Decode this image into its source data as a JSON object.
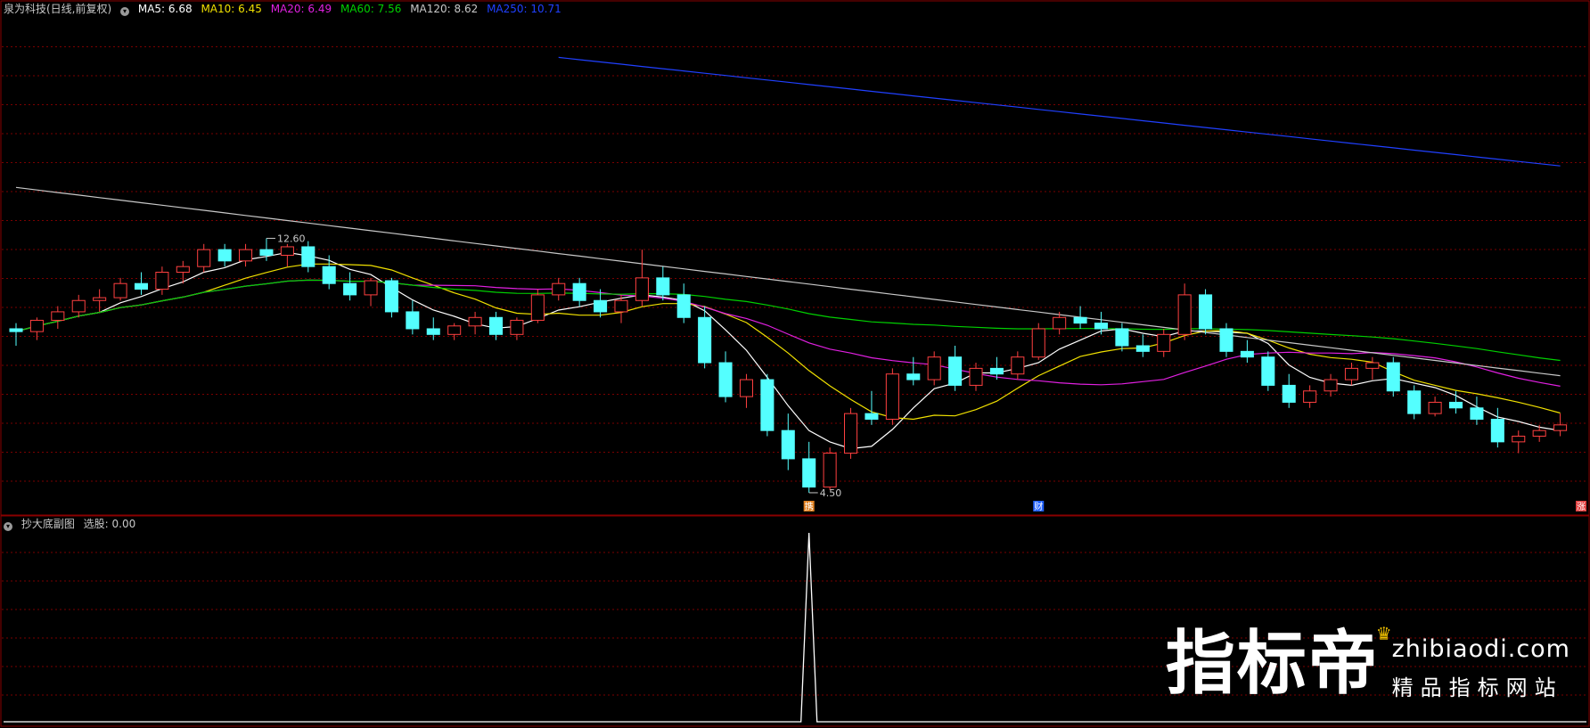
{
  "main_panel": {
    "title": "泉为科技(日线,前复权)",
    "indicators": [
      {
        "label": "MA5: 6.68",
        "color": "#ffffff"
      },
      {
        "label": "MA10: 6.45",
        "color": "#f0e000"
      },
      {
        "label": "MA20: 6.49",
        "color": "#e020e0"
      },
      {
        "label": "MA60: 7.56",
        "color": "#00d000"
      },
      {
        "label": "MA120: 8.62",
        "color": "#c8c8c8"
      },
      {
        "label": "MA250: 10.71",
        "color": "#2040ff"
      }
    ],
    "high_label": "12.60",
    "low_label": "4.50",
    "event_markers": [
      "携",
      "财",
      "涨"
    ]
  },
  "sub_panel": {
    "title": "抄大底副图",
    "value_label": "选股: 0.00"
  },
  "watermark": {
    "brand": "指标帝",
    "url": "zhibiaodi.com",
    "tagline": "精品指标网站"
  },
  "colors": {
    "up": "#ff4040",
    "down": "#54ffff",
    "grid": "#7a0000",
    "background": "#000000"
  },
  "chart_data": {
    "type": "candlestick",
    "ylim": [
      4.2,
      12.9
    ],
    "candles": [
      [
        7.4,
        7.5,
        7.1,
        7.35
      ],
      [
        7.35,
        7.6,
        7.2,
        7.55
      ],
      [
        7.55,
        7.8,
        7.4,
        7.7
      ],
      [
        7.7,
        8.0,
        7.6,
        7.9
      ],
      [
        7.9,
        8.1,
        7.7,
        7.95
      ],
      [
        7.95,
        8.3,
        7.9,
        8.2
      ],
      [
        8.2,
        8.4,
        8.0,
        8.1
      ],
      [
        8.1,
        8.5,
        8.0,
        8.4
      ],
      [
        8.4,
        8.6,
        8.2,
        8.5
      ],
      [
        8.5,
        8.9,
        8.4,
        8.8
      ],
      [
        8.8,
        8.9,
        8.5,
        8.6
      ],
      [
        8.6,
        8.9,
        8.5,
        8.8
      ],
      [
        8.8,
        9.0,
        8.6,
        8.7
      ],
      [
        8.7,
        8.9,
        8.5,
        8.85
      ],
      [
        8.85,
        8.95,
        8.4,
        8.5
      ],
      [
        8.5,
        8.7,
        8.1,
        8.2
      ],
      [
        8.2,
        8.4,
        7.9,
        8.0
      ],
      [
        8.0,
        8.3,
        7.8,
        8.25
      ],
      [
        8.25,
        8.3,
        7.6,
        7.7
      ],
      [
        7.7,
        7.9,
        7.3,
        7.4
      ],
      [
        7.4,
        7.6,
        7.2,
        7.3
      ],
      [
        7.3,
        7.5,
        7.2,
        7.45
      ],
      [
        7.45,
        7.7,
        7.3,
        7.6
      ],
      [
        7.6,
        7.7,
        7.2,
        7.3
      ],
      [
        7.3,
        7.6,
        7.2,
        7.55
      ],
      [
        7.55,
        8.1,
        7.5,
        8.0
      ],
      [
        8.0,
        8.3,
        7.9,
        8.2
      ],
      [
        8.2,
        8.3,
        7.8,
        7.9
      ],
      [
        7.9,
        8.1,
        7.6,
        7.7
      ],
      [
        7.7,
        8.0,
        7.5,
        7.9
      ],
      [
        7.9,
        8.8,
        7.8,
        8.3
      ],
      [
        8.3,
        8.5,
        7.9,
        8.0
      ],
      [
        8.0,
        8.2,
        7.5,
        7.6
      ],
      [
        7.6,
        7.8,
        6.7,
        6.8
      ],
      [
        6.8,
        7.0,
        6.1,
        6.2
      ],
      [
        6.2,
        6.6,
        6.0,
        6.5
      ],
      [
        6.5,
        6.6,
        5.5,
        5.6
      ],
      [
        5.6,
        5.9,
        4.9,
        5.1
      ],
      [
        5.1,
        5.4,
        4.5,
        4.6
      ],
      [
        4.6,
        5.3,
        4.55,
        5.2
      ],
      [
        5.2,
        6.0,
        5.1,
        5.9
      ],
      [
        5.9,
        6.3,
        5.7,
        5.8
      ],
      [
        5.8,
        6.7,
        5.7,
        6.6
      ],
      [
        6.6,
        6.9,
        6.4,
        6.5
      ],
      [
        6.5,
        7.0,
        6.4,
        6.9
      ],
      [
        6.9,
        7.1,
        6.3,
        6.4
      ],
      [
        6.4,
        6.8,
        6.3,
        6.7
      ],
      [
        6.7,
        6.9,
        6.5,
        6.6
      ],
      [
        6.6,
        7.0,
        6.5,
        6.9
      ],
      [
        6.9,
        7.5,
        6.85,
        7.4
      ],
      [
        7.4,
        7.7,
        7.3,
        7.6
      ],
      [
        7.6,
        7.8,
        7.4,
        7.5
      ],
      [
        7.5,
        7.7,
        7.3,
        7.4
      ],
      [
        7.4,
        7.5,
        7.0,
        7.1
      ],
      [
        7.1,
        7.3,
        6.9,
        7.0
      ],
      [
        7.0,
        7.4,
        6.9,
        7.3
      ],
      [
        7.3,
        8.2,
        7.2,
        8.0
      ],
      [
        8.0,
        8.1,
        7.3,
        7.4
      ],
      [
        7.4,
        7.5,
        6.9,
        7.0
      ],
      [
        7.0,
        7.2,
        6.8,
        6.9
      ],
      [
        6.9,
        7.0,
        6.3,
        6.4
      ],
      [
        6.4,
        6.6,
        6.0,
        6.1
      ],
      [
        6.1,
        6.4,
        6.0,
        6.3
      ],
      [
        6.3,
        6.6,
        6.2,
        6.5
      ],
      [
        6.5,
        6.8,
        6.4,
        6.7
      ],
      [
        6.7,
        6.9,
        6.5,
        6.8
      ],
      [
        6.8,
        6.9,
        6.2,
        6.3
      ],
      [
        6.3,
        6.4,
        5.8,
        5.9
      ],
      [
        5.9,
        6.2,
        5.85,
        6.1
      ],
      [
        6.1,
        6.3,
        5.9,
        6.0
      ],
      [
        6.0,
        6.2,
        5.7,
        5.8
      ],
      [
        5.8,
        6.0,
        5.3,
        5.4
      ],
      [
        5.4,
        5.6,
        5.2,
        5.5
      ],
      [
        5.5,
        5.7,
        5.4,
        5.6
      ],
      [
        5.6,
        5.9,
        5.5,
        5.7
      ]
    ],
    "sub_series": {
      "type": "line",
      "name": "选股",
      "spike_index": 38,
      "spike_value": 1.0
    }
  }
}
